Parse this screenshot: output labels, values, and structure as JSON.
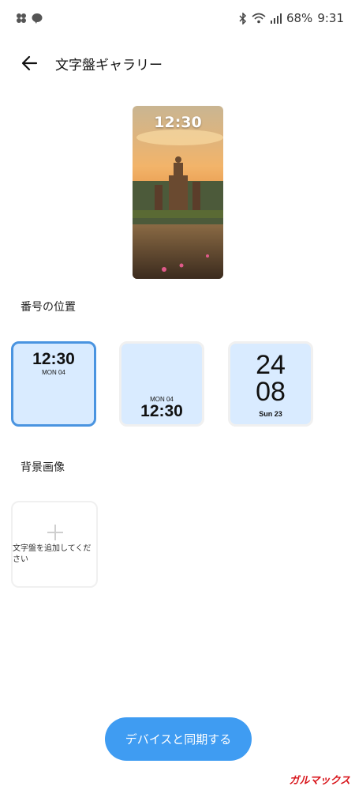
{
  "status_bar": {
    "battery": "68%",
    "time": "9:31",
    "notification_icons": [
      "cluster-icon",
      "line-icon"
    ],
    "system_icons": [
      "bluetooth-icon",
      "wifi-icon",
      "signal-icon"
    ]
  },
  "header": {
    "back_icon": "arrow-left-icon",
    "title": "文字盤ギャラリー"
  },
  "preview": {
    "time": "12:30"
  },
  "number_position": {
    "label": "番号の位置",
    "selected_index": 0,
    "options": [
      {
        "time": "12:30",
        "date": "MON 04"
      },
      {
        "time": "12:30",
        "date": "MON 04"
      },
      {
        "hour": "24",
        "minute": "08",
        "date": "Sun 23"
      }
    ]
  },
  "background": {
    "label": "背景画像",
    "add_text": "文字盤を追加してください",
    "add_icon": "plus-icon"
  },
  "sync_button": "デバイスと同期する",
  "watermark": "ガルマックス",
  "colors": {
    "accent": "#3f9cf2",
    "tile_bg": "#d9ebff",
    "selected_border": "#4a94e0"
  }
}
